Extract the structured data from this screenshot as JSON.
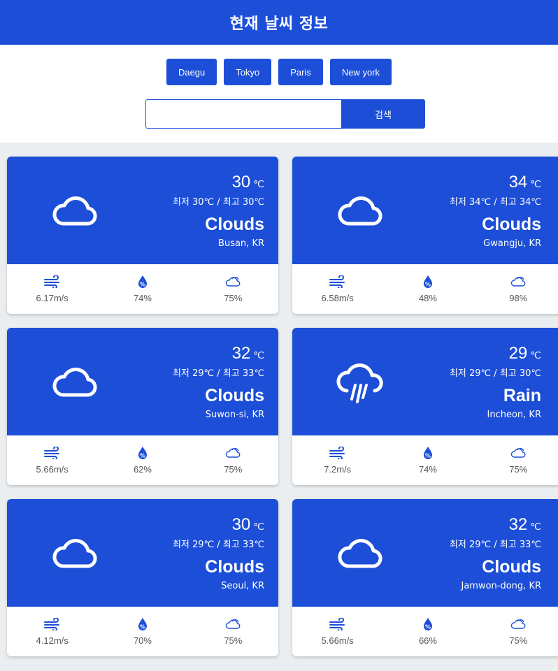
{
  "header": {
    "title": "현재 날씨 정보"
  },
  "city_buttons": [
    "Daegu",
    "Tokyo",
    "Paris",
    "New york"
  ],
  "search": {
    "value": "",
    "placeholder": "",
    "button_label": "검색"
  },
  "colors": {
    "accent": "#1c4ed8",
    "background": "#ebeef0"
  },
  "cards": [
    {
      "icon": "cloud-icon",
      "temp": "30",
      "unit": "℃",
      "minmax": "최저 30℃ / 최고 30℃",
      "condition": "Clouds",
      "location": "Busan, KR",
      "wind": "6.17m/s",
      "humidity": "74%",
      "cloudiness": "75%"
    },
    {
      "icon": "cloud-icon",
      "temp": "34",
      "unit": "℃",
      "minmax": "최저 34℃ / 최고 34℃",
      "condition": "Clouds",
      "location": "Gwangju, KR",
      "wind": "6.58m/s",
      "humidity": "48%",
      "cloudiness": "98%"
    },
    {
      "icon": "cloud-icon",
      "temp": "32",
      "unit": "℃",
      "minmax": "최저 29℃ / 최고 33℃",
      "condition": "Clouds",
      "location": "Suwon-si, KR",
      "wind": "5.66m/s",
      "humidity": "62%",
      "cloudiness": "75%"
    },
    {
      "icon": "rain-cloud-icon",
      "temp": "29",
      "unit": "℃",
      "minmax": "최저 29℃ / 최고 30℃",
      "condition": "Rain",
      "location": "Incheon, KR",
      "wind": "7.2m/s",
      "humidity": "74%",
      "cloudiness": "75%"
    },
    {
      "icon": "cloud-icon",
      "temp": "30",
      "unit": "℃",
      "minmax": "최저 29℃ / 최고 33℃",
      "condition": "Clouds",
      "location": "Seoul, KR",
      "wind": "4.12m/s",
      "humidity": "70%",
      "cloudiness": "75%"
    },
    {
      "icon": "cloud-icon",
      "temp": "32",
      "unit": "℃",
      "minmax": "최저 29℃ / 최고 33℃",
      "condition": "Clouds",
      "location": "Jamwon-dong, KR",
      "wind": "5.66m/s",
      "humidity": "66%",
      "cloudiness": "75%"
    }
  ]
}
